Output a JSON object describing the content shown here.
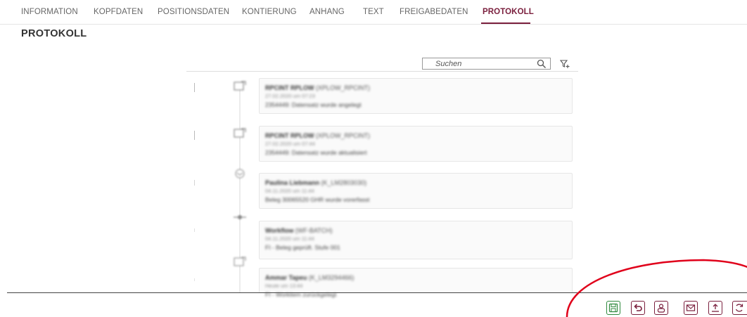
{
  "tabs": [
    {
      "label": "INFORMATION"
    },
    {
      "label": "KOPFDATEN"
    },
    {
      "label": "POSITIONSDATEN"
    },
    {
      "label": "KONTIERUNG"
    },
    {
      "label": "ANHANG"
    },
    {
      "label": "TEXT"
    },
    {
      "label": "FREIGABEDATEN"
    },
    {
      "label": "PROTOKOLL",
      "active": true
    }
  ],
  "page": {
    "title": "PROTOKOLL"
  },
  "search": {
    "placeholder": "Suchen",
    "value": ""
  },
  "icons": {
    "search": "search-icon",
    "filter": "filter-add-icon"
  },
  "protocol_entries": [
    {
      "name": "RPCINT RPLOW",
      "user_id": "(XPLOW_RPCINT)",
      "date": "27.02.2020 um 07:23",
      "message": "2354449: Datensatz wurde angelegt",
      "icon": "document-edit-icon"
    },
    {
      "name": "RPCINT RPLOW",
      "user_id": "(XPLOW_RPCINT)",
      "date": "27.02.2020 um 07:44",
      "message": "2354449: Datensatz wurde aktualisiert",
      "icon": "document-edit-icon"
    },
    {
      "name": "Paulina Liebmann",
      "user_id": "(K_LM2803030)",
      "date": "04.11.2020 um 11:44",
      "message": "Beleg 30065520 GHR wurde vorerfasst",
      "icon": "mail-icon"
    },
    {
      "name": "Workflow",
      "user_id": "(WF-BATCH)",
      "date": "04.11.2020 um 11:44",
      "message": "FI - Beleg geprüft. Stufe 001",
      "icon": "workflow-icon"
    },
    {
      "name": "Ammar Tapeu",
      "user_id": "(K_LM3294466)",
      "date": "Heute um 13:44",
      "message": "FI - Workitem zurückgelegt",
      "icon": "document-edit-icon"
    }
  ],
  "footer_buttons": [
    {
      "name": "save",
      "icon": "save-icon"
    },
    {
      "name": "undo",
      "icon": "undo-icon"
    },
    {
      "name": "user",
      "icon": "user-icon"
    },
    {
      "name": "mail",
      "icon": "mail-icon"
    },
    {
      "name": "upload",
      "icon": "upload-icon"
    },
    {
      "name": "refresh",
      "icon": "refresh-icon"
    }
  ],
  "colors": {
    "accent": "#7a1f3d",
    "save": "#2f8a3e",
    "annotation": "#e0001a"
  }
}
